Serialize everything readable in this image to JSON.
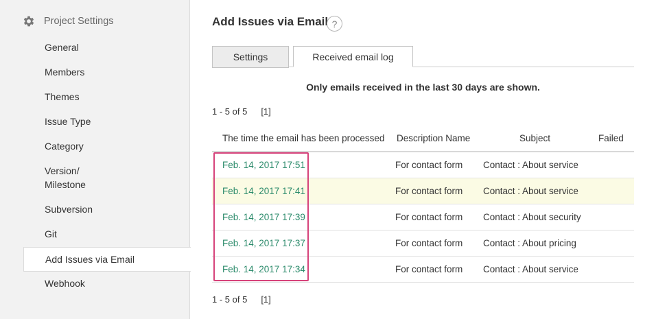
{
  "sidebar": {
    "title": "Project Settings",
    "items": [
      {
        "label": "General"
      },
      {
        "label": "Members"
      },
      {
        "label": "Themes"
      },
      {
        "label": "Issue Type"
      },
      {
        "label": "Category"
      },
      {
        "label": "Version/",
        "label2": "Milestone"
      },
      {
        "label": "Subversion"
      },
      {
        "label": "Git"
      },
      {
        "label": "Add Issues via Email"
      },
      {
        "label": "Webhook"
      }
    ]
  },
  "main": {
    "title": "Add Issues via Email",
    "help": "?",
    "tabs": [
      {
        "label": "Settings"
      },
      {
        "label": "Received email log"
      }
    ],
    "notice": "Only emails received in the last 30 days are shown.",
    "pager": {
      "count": "1 - 5 of 5",
      "page": "[1]"
    },
    "table": {
      "headers": [
        "The time the email has been processed",
        "Description Name",
        "Subject",
        "Failed"
      ],
      "rows": [
        {
          "time": "Feb. 14, 2017 17:51",
          "description": "For contact form",
          "subject": "Contact : About service",
          "failed": ""
        },
        {
          "time": "Feb. 14, 2017 17:41",
          "description": "For contact form",
          "subject": "Contact : About service",
          "failed": ""
        },
        {
          "time": "Feb. 14, 2017 17:39",
          "description": "For contact form",
          "subject": "Contact : About security",
          "failed": ""
        },
        {
          "time": "Feb. 14, 2017 17:37",
          "description": "For contact form",
          "subject": "Contact : About pricing",
          "failed": ""
        },
        {
          "time": "Feb. 14, 2017 17:34",
          "description": "For contact form",
          "subject": "Contact : About service",
          "failed": ""
        }
      ]
    }
  },
  "colors": {
    "link": "#2a8a6a",
    "highlight_row": "#fbfbe4",
    "annotation_box": "#d6427a",
    "sidebar_bg": "#f2f2f2"
  }
}
